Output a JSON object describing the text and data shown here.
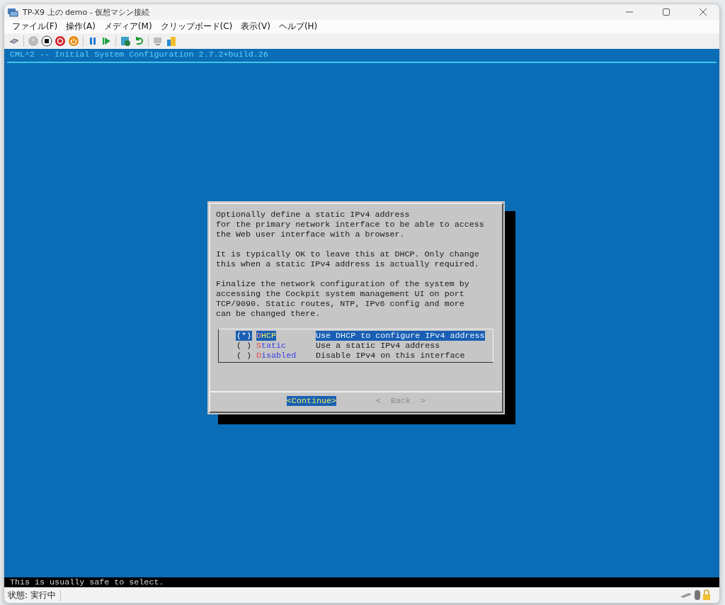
{
  "window": {
    "title": "TP-X9 上の demo  - 仮想マシン接続"
  },
  "menu": [
    "ファイル(F)",
    "操作(A)",
    "メディア(M)",
    "クリップボード(C)",
    "表示(V)",
    "ヘルプ(H)"
  ],
  "terminal": {
    "header": "CML^2 -- Initial System Configuration 2.7.2+build.26",
    "dialog": {
      "paragraphs": [
        [
          "Optionally define a static IPv4 address",
          "for the primary network interface to be able to access",
          "the Web user interface with a browser."
        ],
        [
          "It is typically OK to leave this at DHCP. Only change",
          "this when a static IPv4 address is actually required."
        ],
        [
          "Finalize the network configuration of the system by",
          "accessing the Cockpit system management UI on port",
          "TCP/9090. Static routes, NTP, IPv6 config and more",
          "can be changed there."
        ]
      ],
      "options": [
        {
          "marker": "(*)",
          "hotkey": "D",
          "rest": "HCP",
          "description": "Use DHCP to configure IPv4 address",
          "selected": true
        },
        {
          "marker": "( )",
          "hotkey": "S",
          "rest": "tatic",
          "description": "Use a static IPv4 address",
          "selected": false
        },
        {
          "marker": "( )",
          "hotkey": "D",
          "rest": "isabled",
          "description": "Disable IPv4 on this interface",
          "selected": false
        }
      ],
      "buttons": [
        {
          "label": "<Continue>",
          "selected": true,
          "disabled": false
        },
        {
          "label": "<  Back  >",
          "selected": false,
          "disabled": true
        }
      ]
    },
    "hint": "This is usually safe to select."
  },
  "status_bar": {
    "state": "状態: 実行中"
  }
}
